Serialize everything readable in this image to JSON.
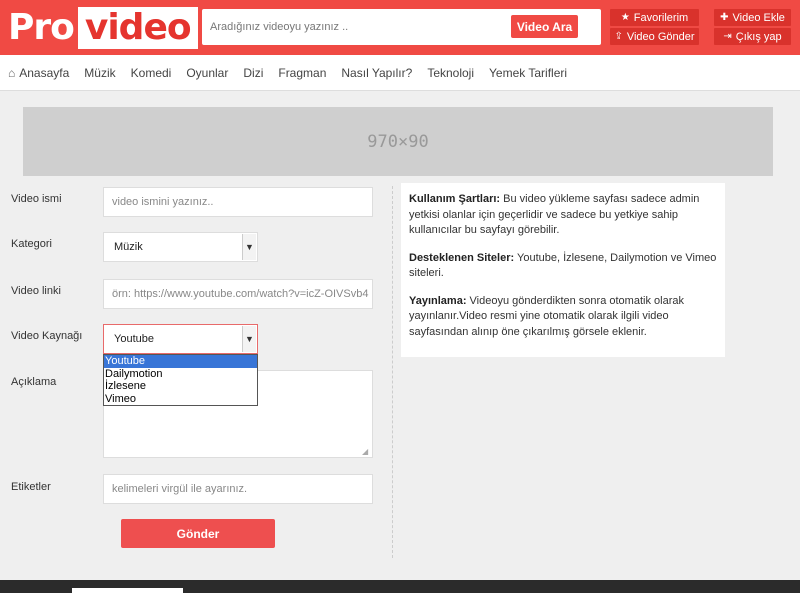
{
  "brand": {
    "logo_part1": "Pro",
    "logo_part2": "video"
  },
  "search": {
    "placeholder": "Aradığınız videoyu yazınız ..",
    "button_label": "Video Ara"
  },
  "header_buttons": {
    "favorites": {
      "label": "Favorilerim",
      "icon": "star-icon"
    },
    "upload": {
      "label": "Video Gönder",
      "icon": "upload-icon"
    },
    "add_video": {
      "label": "Video Ekle",
      "icon": "plus-icon"
    },
    "logout": {
      "label": "Çıkış yap",
      "icon": "logout-icon"
    }
  },
  "nav": {
    "items": [
      "Anasayfa",
      "Müzik",
      "Komedi",
      "Oyunlar",
      "Dizi",
      "Fragman",
      "Nasıl Yapılır?",
      "Teknoloji",
      "Yemek Tarifleri"
    ]
  },
  "ad": {
    "label": "970×90"
  },
  "form": {
    "video_name": {
      "label": "Video ismi",
      "placeholder": "video ismini yazınız.."
    },
    "category": {
      "label": "Kategori",
      "selected": "Müzik"
    },
    "video_link": {
      "label": "Video linki",
      "placeholder": "örn: https://www.youtube.com/watch?v=icZ-OIVSvb4"
    },
    "video_source": {
      "label": "Video Kaynağı",
      "selected": "Youtube",
      "options": [
        "Youtube",
        "Dailymotion",
        "İzlesene",
        "Vimeo"
      ]
    },
    "description": {
      "label": "Açıklama",
      "placeholder": "Açıklama yazınız.."
    },
    "tags": {
      "label": "Etiketler",
      "placeholder": "kelimeleri virgül ile ayarınız."
    },
    "submit_label": "Gönder"
  },
  "info": {
    "terms": {
      "title": "Kullanım Şartları:",
      "text": " Bu video yükleme sayfası sadece admin yetkisi olanlar için geçerlidir ve sadece bu yetkiye sahip kullanıcılar bu sayfayı görebilir."
    },
    "supported": {
      "title": "Desteklenen Siteler:",
      "text": " Youtube, İzlesene, Dailymotion ve Vimeo siteleri."
    },
    "publishing": {
      "title": "Yayınlama:",
      "text": " Videoyu gönderdikten sonra otomatik olarak yayınlanır.Video resmi yine otomatik olarak ilgili video sayfasından alınıp öne çıkarılmış görsele eklenir."
    }
  },
  "colors": {
    "brand_red": "#f04a44",
    "dark_red": "#d9322c",
    "selection_blue": "#3875d7"
  }
}
